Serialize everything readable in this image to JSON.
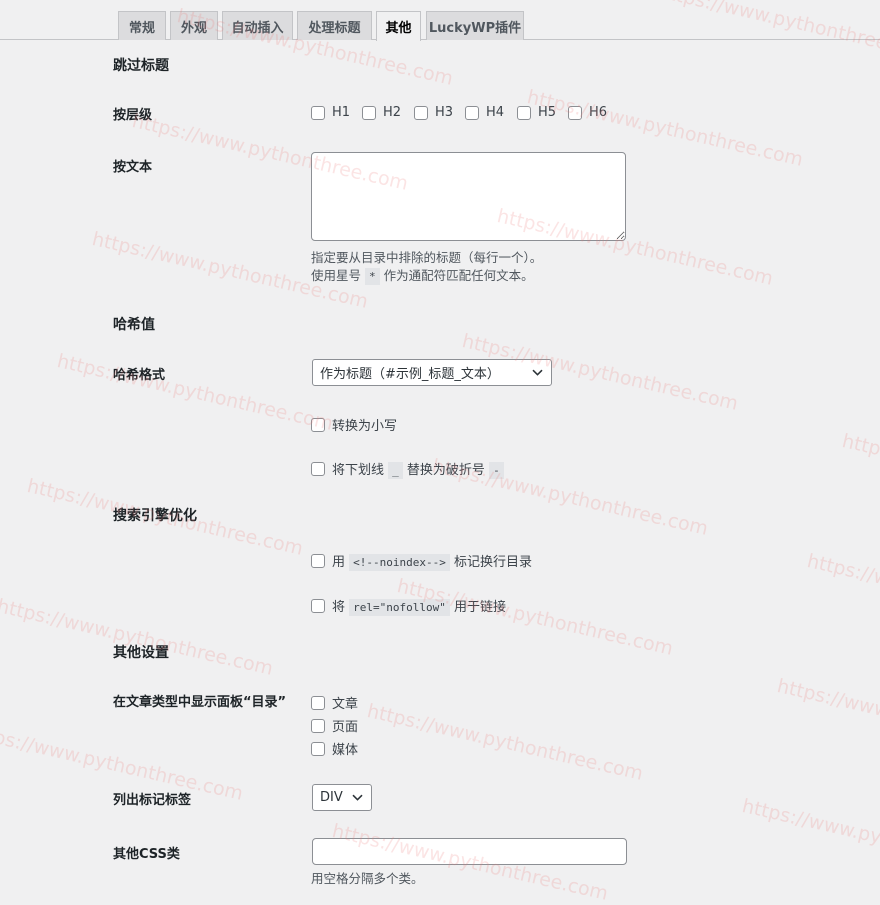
{
  "tabs": [
    "常规",
    "外观",
    "自动插入",
    "处理标题",
    "其他",
    "LuckyWP插件"
  ],
  "sections": {
    "skip_headings": "跳过标题",
    "hash": "哈希值",
    "seo": "搜索引擎优化",
    "other": "其他设置"
  },
  "by_level": {
    "label": "按层级",
    "options": [
      "H1",
      "H2",
      "H3",
      "H4",
      "H5",
      "H6"
    ]
  },
  "by_text": {
    "label": "按文本",
    "desc_line1": "指定要从目录中排除的标题（每行一个）。",
    "desc_line2_pre": "使用星号",
    "desc_line2_code": "*",
    "desc_line2_post": "作为通配符匹配任何文本。"
  },
  "hash_format": {
    "label": "哈希格式",
    "value": "作为标题（#示例_标题_文本）",
    "lowercase": "转换为小写",
    "replace_pre": "将下划线",
    "replace_code1": "_",
    "replace_mid": "替换为破折号",
    "replace_code2": "-"
  },
  "seo": {
    "noindex_pre": "用",
    "noindex_code": "<!--noindex-->",
    "noindex_post": "标记换行目录",
    "nofollow_pre": "将",
    "nofollow_code": "rel=\"nofollow\"",
    "nofollow_post": "用于链接"
  },
  "post_types": {
    "label": "在文章类型中显示面板“目录”",
    "options": [
      "文章",
      "页面",
      "媒体"
    ]
  },
  "list_tag": {
    "label": "列出标记标签",
    "value": "DIV"
  },
  "css_class": {
    "label": "其他CSS类",
    "desc": "用空格分隔多个类。"
  },
  "watermark": "https://www.pythonthree.com"
}
